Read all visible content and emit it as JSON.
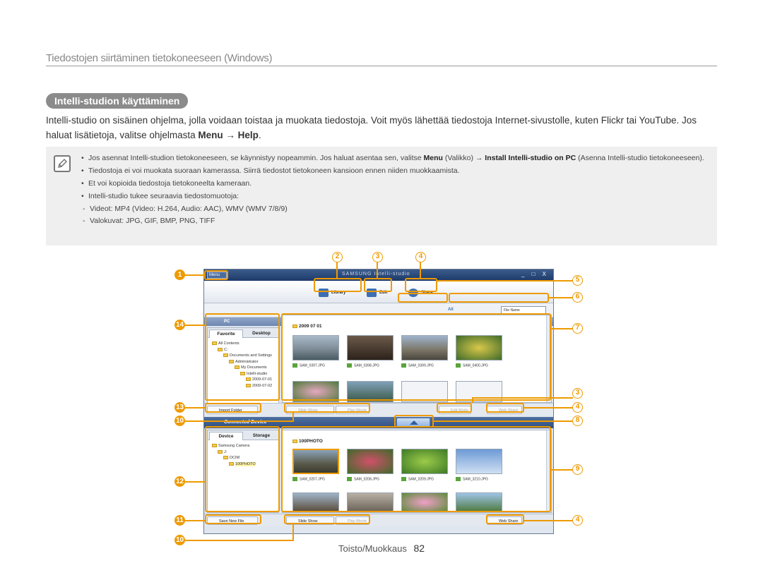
{
  "section_header": "Tiedostojen siirtäminen tietokoneeseen (Windows)",
  "section_title": "Intelli-studion käyttäminen",
  "intro": {
    "text": "Intelli-studio on sisäinen ohjelma, jolla voidaan toistaa ja muokata tiedostoja. Voit myös lähettää tiedostoja Internet-sivustolle, kuten Flickr tai YouTube. Jos haluat lisätietoja, valitse ohjelmasta",
    "menu": "Menu",
    "arrow": "→",
    "help": "Help",
    "end": "."
  },
  "note": {
    "icon": "note-pencil-icon",
    "item1_a": "Jos asennat Intelli-studion tietokoneeseen, se käynnistyy nopeammin. Jos haluat asentaa sen, valitse",
    "item1_menu": "Menu",
    "item1_b": "(Valikko) →",
    "item1_install": "Install Intelli-studio on PC",
    "item1_c": "(Asenna Intelli-studio tietokoneeseen).",
    "item2": "Tiedostoja ei voi muokata suoraan kamerassa. Siirrä tiedostot tietokoneen kansioon ennen niiden muokkaamista.",
    "item3": "Et voi kopioida tiedostoja tietokoneelta kameraan.",
    "item4": "Intelli-studio tukee seuraavia tiedostomuotoja:",
    "sub1": "Videot: MP4 (Video: H.264, Audio: AAC), WMV (WMV 7/8/9)",
    "sub2": "Valokuvat: JPG, GIF, BMP, PNG, TIFF"
  },
  "callouts": [
    "1",
    "2",
    "3",
    "4",
    "5",
    "6",
    "7",
    "3",
    "4",
    "8",
    "9",
    "10",
    "11",
    "12",
    "13",
    "14",
    "10",
    "4"
  ],
  "app": {
    "menu": "Menu",
    "brand": "SAMSUNG Intelli-studio",
    "window_controls": "_ □ X",
    "library": "Library",
    "edit": "Edit",
    "share": "Share",
    "all": "All",
    "file_name": "File Name",
    "pc": "PC",
    "tab_favorite": "Favorite",
    "tab_desktop": "Desktop",
    "tree": [
      "All Contents",
      "C:",
      "Documents and Settings",
      "Administrator",
      "My Documents",
      "Intelli-studio",
      "2009-07-01",
      "2009-07-02"
    ],
    "date_folder": "2009 07 01",
    "pc_files": [
      "SAM_0397.JPG",
      "SAM_0398.JPG",
      "SAM_0399.JPG",
      "SAM_0400.JPG"
    ],
    "import_folder": "Import Folder",
    "slide_show": "Slide Show",
    "play_movie": "Play Movie",
    "edit_mode": "Edit Mode",
    "web_share": "Web Share",
    "connected_device": "Connected Device",
    "tab_device": "Device",
    "tab_storage": "Storage",
    "dev_tree": [
      "Samsung Camera",
      "J:",
      "DCIM",
      "100PHOTO"
    ],
    "dev_folder": "100PHOTO",
    "dev_files": [
      "SAM_0207.JPG",
      "SAM_0208.JPG",
      "SAM_0209.JPG",
      "SAM_3210.JPG"
    ],
    "save_new_file": "Save New File"
  },
  "footer": {
    "label": "Toisto/Muokkaus",
    "page": "82"
  }
}
